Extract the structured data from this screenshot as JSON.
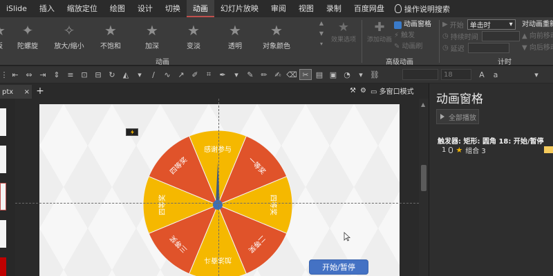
{
  "menu": {
    "items": [
      "iSlide",
      "插入",
      "缩放定位",
      "绘图",
      "设计",
      "切换",
      "动画",
      "幻灯片放映",
      "审阅",
      "视图",
      "录制",
      "百度网盘"
    ],
    "active": "动画",
    "search_label": "操作说明搜索"
  },
  "ribbon": {
    "animations": [
      "板",
      "陀螺旋",
      "放大/缩小",
      "不饱和",
      "加深",
      "变淡",
      "透明",
      "对象颜色"
    ],
    "effect_options": "效果选项",
    "group_animation": "动画",
    "add_animation": "添加动画",
    "advanced": {
      "pane": "动画窗格",
      "trigger": "触发",
      "painter": "动画刷"
    },
    "group_advanced": "高级动画",
    "timing": {
      "start_label": "开始",
      "start_value": "单击时",
      "duration_label": "持续时间",
      "delay_label": "延迟"
    },
    "group_timing": "计时",
    "reorder": {
      "title": "对动画重新排序",
      "earlier": "向前移动",
      "later": "向后移动"
    }
  },
  "toolbar": {
    "font_size": "18"
  },
  "tabs": {
    "doc": "ptx",
    "multi_window": "多窗口模式"
  },
  "slide": {
    "wheel_segments": [
      "感谢参与",
      "一等奖",
      "四等奖",
      "二等奖",
      "加油奋斗",
      "三等奖",
      "四等奖",
      "四等奖"
    ],
    "start_button": "开始/暂停"
  },
  "anim_pane": {
    "title": "动画窗格",
    "play_all": "全部播放",
    "trigger_text": "触发器: 矩形: 圆角 18: 开始/暂停",
    "item_index": "1",
    "item_name": "组合 3"
  },
  "colors": {
    "accent_red": "#c0504d",
    "wheel_orange": "#e0532a",
    "wheel_yellow": "#f5b800",
    "button_blue": "#4472c4"
  }
}
